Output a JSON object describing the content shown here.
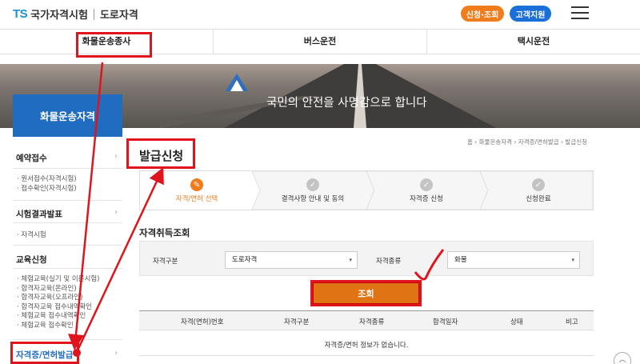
{
  "header": {
    "logo_mark": "TS",
    "logo_name": "국가자격시험",
    "logo_sub": "도로자격",
    "apply_button": "신청·조회",
    "support_button": "고객지원"
  },
  "topnav": [
    "화물운송종사",
    "버스운전",
    "택시운전"
  ],
  "banner": {
    "text": "국민의 안전을 사명감으로 합니다"
  },
  "sidebar": {
    "title": "화물운송자격",
    "sections": [
      {
        "label": "예약접수",
        "items": [
          "원서접수(자격시험)",
          "접수확인(자격시험)"
        ]
      },
      {
        "label": "시험결과발표",
        "items": [
          "자격시험"
        ]
      },
      {
        "label": "교육신청",
        "items": [
          "체험교육(실기 및 이론시험)",
          "합격자교육(온라인)",
          "합격자교육(오프라인)",
          "합격자교육 접수내역확인",
          "체험교육 접수내역확인",
          "체험교육 접수확인"
        ]
      },
      {
        "label": "자격증/면허발급",
        "items": []
      }
    ]
  },
  "breadcrumb": "홈 › 화물운송자격 › 자격증/면허발급 › 발급신청",
  "page_title": "발급신청",
  "steps": [
    "자격/면허 선택",
    "결격사항 안내 및 동의",
    "자격증 신청",
    "신청완료"
  ],
  "section_title": "자격취득조회",
  "form": {
    "category_label": "자격구분",
    "category_value": "도로자격",
    "type_label": "자격종류",
    "type_value": "화물"
  },
  "search_button": "조회",
  "table": {
    "headers": [
      "자격(면허)번호",
      "자격구분",
      "자격종류",
      "합격일자",
      "상태",
      "비고"
    ],
    "empty_message": "자격증/면허 정보가 없습니다."
  },
  "colors": {
    "accent": "#f07c1c",
    "primary": "#1f6cc0",
    "annotation": "#e0141c"
  }
}
